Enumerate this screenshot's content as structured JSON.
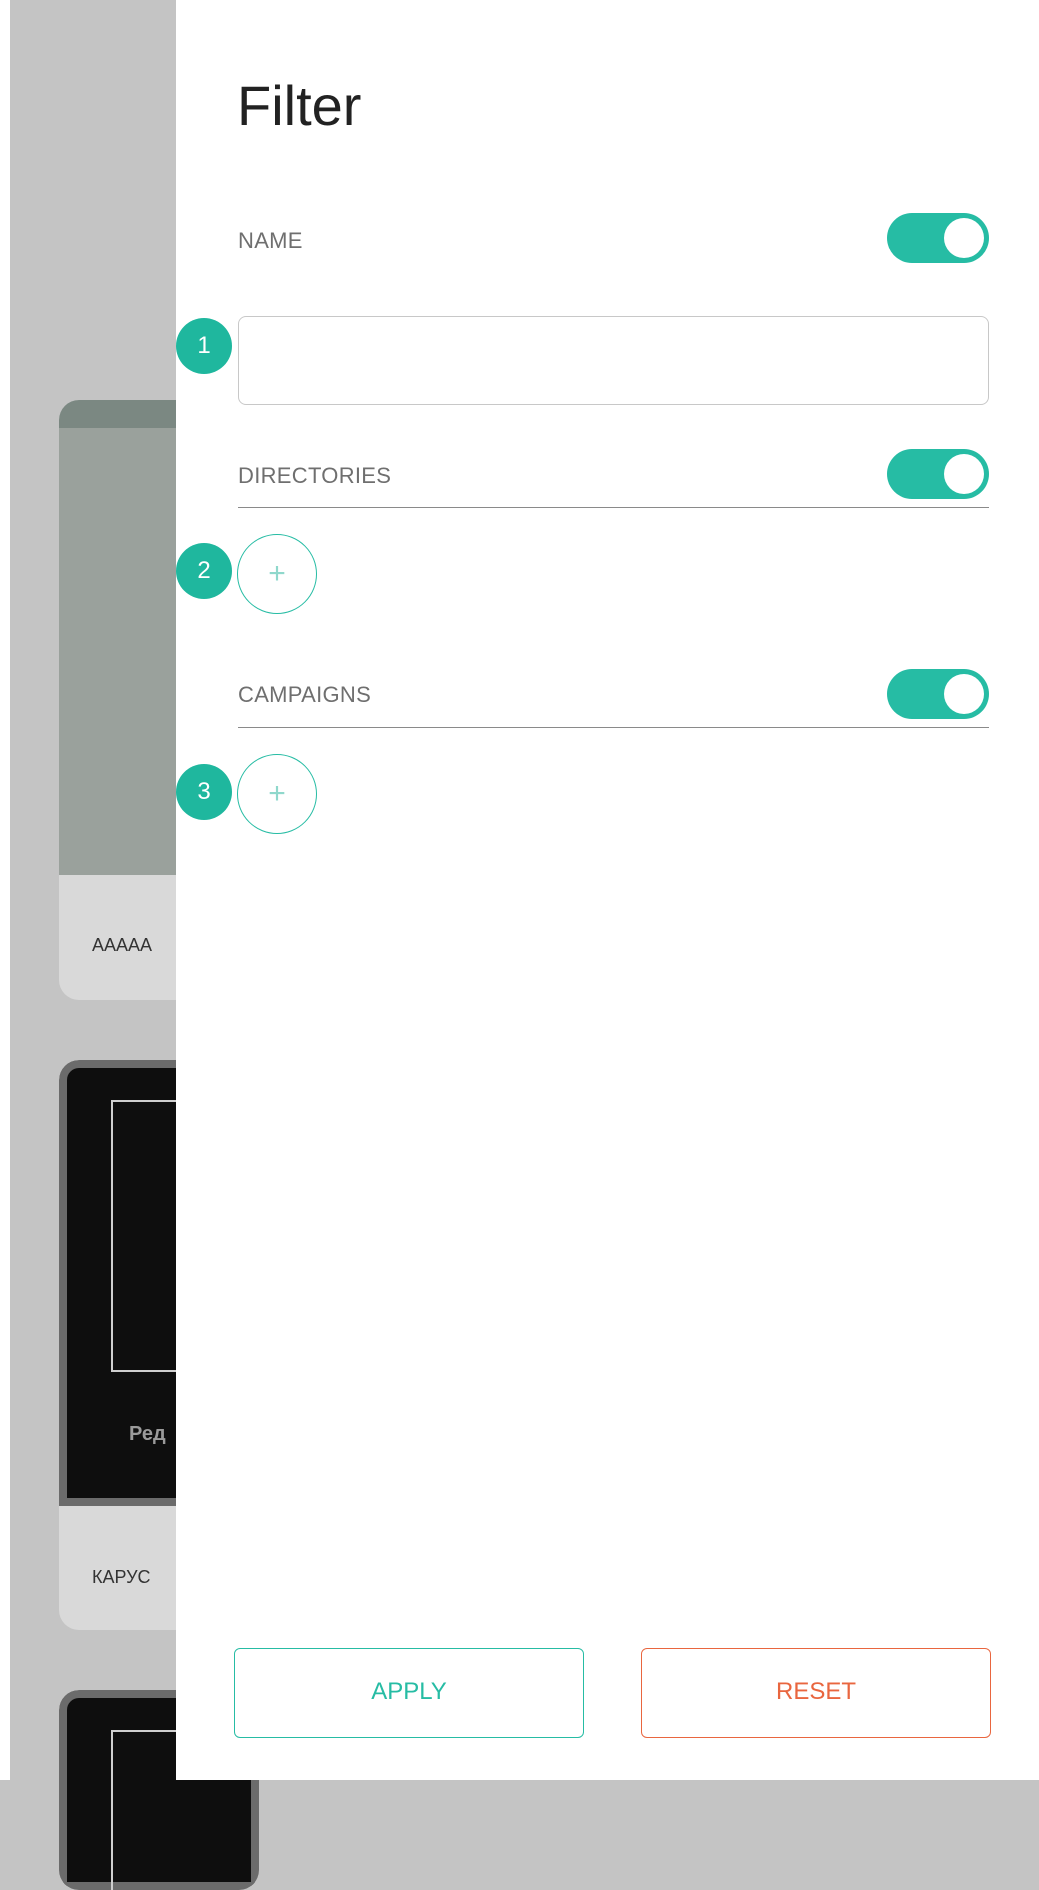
{
  "background": {
    "cards": [
      {
        "caption": "AAAAA"
      },
      {
        "thumb_text": "Ред",
        "caption": "КАРУС"
      },
      {}
    ]
  },
  "filter": {
    "title": "Filter",
    "name": {
      "label": "NAME",
      "toggle_on": true,
      "input_value": "",
      "input_placeholder": "",
      "step": "1"
    },
    "directories": {
      "label": "DIRECTORIES",
      "toggle_on": true,
      "step": "2",
      "add_icon": "plus-icon"
    },
    "campaigns": {
      "label": "CAMPAIGNS",
      "toggle_on": true,
      "step": "3",
      "add_icon": "plus-icon"
    },
    "apply_label": "APPLY",
    "reset_label": "RESET"
  },
  "colors": {
    "accent": "#26bca4",
    "reset": "#e9663f",
    "overlay": "#c4c4c4"
  }
}
